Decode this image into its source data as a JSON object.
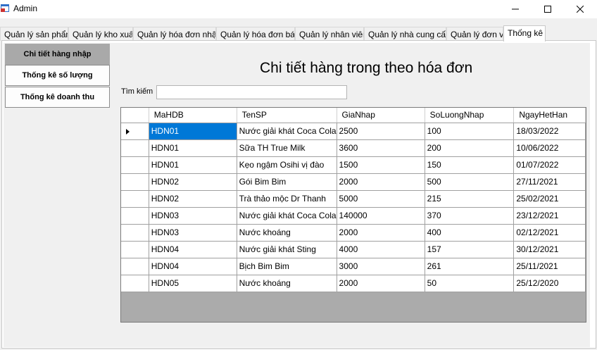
{
  "window": {
    "title": "Admin",
    "buttons": {
      "minimize": "—",
      "maximize": "☐",
      "close": "✕"
    }
  },
  "tabs": [
    "Quản lý sản phẩm",
    "Quản lý kho xuất",
    "Quản lý hóa đơn nhập",
    "Quản lý hóa đơn bán",
    "Quản lý nhân viên",
    "Quản lý nhà cung cấp",
    "Quản lý đơn vị",
    "Thống kê"
  ],
  "active_tab": "Thống kê",
  "sidebar": {
    "items": [
      "Chi tiết hàng nhập",
      "Thống kê số lượng",
      "Thống kê doanh thu"
    ],
    "active": "Chi tiết hàng nhập"
  },
  "main": {
    "heading": "Chi tiết hàng trong theo hóa đơn",
    "search_label": "Tìm kiếm",
    "search_value": "",
    "grid": {
      "columns": [
        "MaHDB",
        "TenSP",
        "GiaNhap",
        "SoLuongNhap",
        "NgayHetHan"
      ],
      "rows": [
        [
          "HDN01",
          "Nước giải khát Coca Cola",
          "2500",
          "100",
          "18/03/2022"
        ],
        [
          "HDN01",
          "Sữa TH True Milk",
          "3600",
          "200",
          "10/06/2022"
        ],
        [
          "HDN01",
          "Kẹo ngậm Osihi vị đào",
          "1500",
          "150",
          "01/07/2022"
        ],
        [
          "HDN02",
          "Gói Bim Bim",
          "2000",
          "500",
          "27/11/2021"
        ],
        [
          "HDN02",
          "Trà thảo mộc Dr Thanh",
          "5000",
          "215",
          "25/02/2021"
        ],
        [
          "HDN03",
          "Nước giải khát Coca Cola",
          "140000",
          "370",
          "23/12/2021"
        ],
        [
          "HDN03",
          "Nước khoáng",
          "2000",
          "400",
          "02/12/2021"
        ],
        [
          "HDN04",
          "Nước giải khát Sting",
          "4000",
          "157",
          "30/12/2021"
        ],
        [
          "HDN04",
          "Bịch Bim Bim",
          "3000",
          "261",
          "25/11/2021"
        ],
        [
          "HDN05",
          "Nước khoáng",
          "2000",
          "50",
          "25/12/2020"
        ]
      ],
      "selected_row": 0
    }
  },
  "colors": {
    "selection": "#0078d7",
    "grid_background": "#ababab",
    "active_nav": "#a9a9a9",
    "panel": "#f0f0f0"
  }
}
